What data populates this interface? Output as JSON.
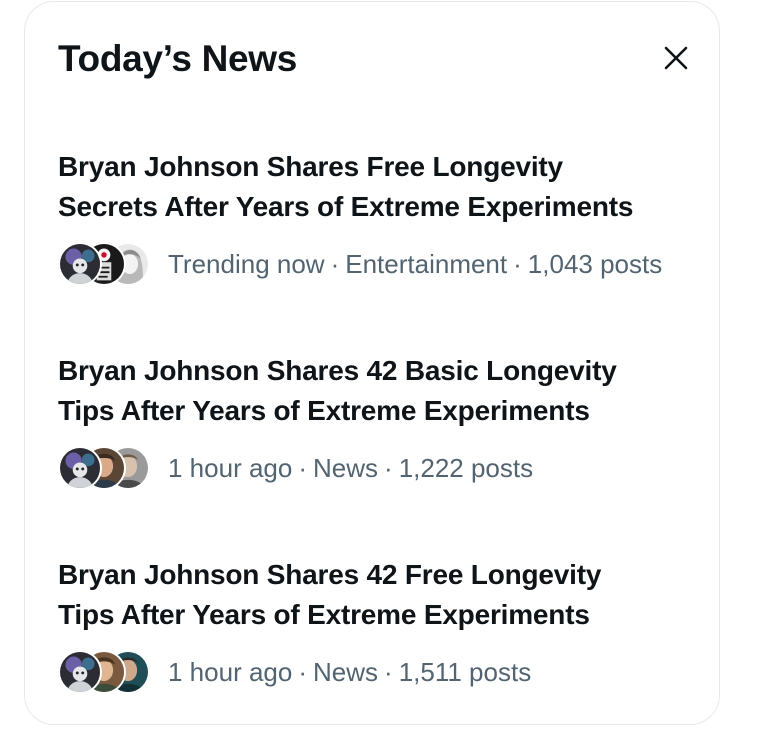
{
  "panel": {
    "title": "Today’s News",
    "close_icon": "close-icon"
  },
  "items": [
    {
      "title_line1": "Bryan Johnson Shares Free Longevity",
      "title_line2": "Secrets After Years of Extreme Experiments",
      "time": "Trending now",
      "category": "Entertainment",
      "posts": "1,043 posts"
    },
    {
      "title_line1": "Bryan Johnson Shares 42 Basic Longevity",
      "title_line2": "Tips After Years of Extreme Experiments",
      "time": "1 hour ago",
      "category": "News",
      "posts": "1,222 posts"
    },
    {
      "title_line1": "Bryan Johnson Shares 42 Free Longevity",
      "title_line2": "Tips After Years of Extreme Experiments",
      "time": "1 hour ago",
      "category": "News",
      "posts": "1,511 posts"
    }
  ],
  "separator": "·",
  "colors": {
    "text": "#0f1419",
    "secondary_text": "#536471",
    "border": "#e6e9ec"
  }
}
